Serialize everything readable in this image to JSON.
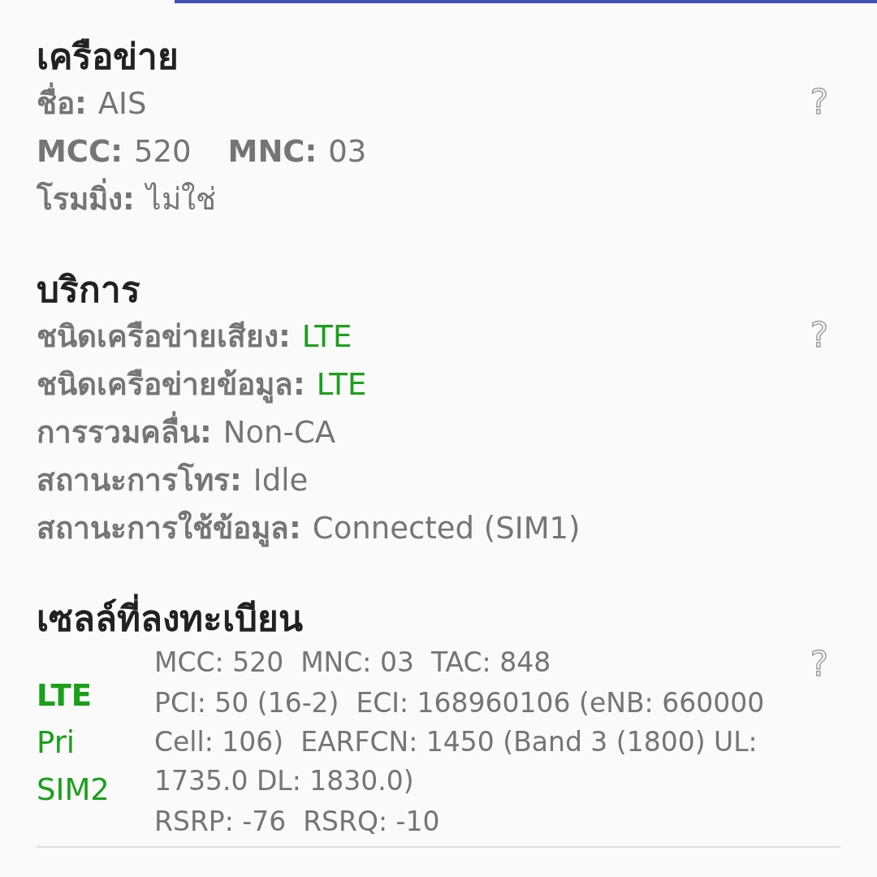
{
  "sections": [
    {
      "kind": "fields",
      "title": "เครือข่าย",
      "help": "?",
      "rows": [
        [
          {
            "label": "ชื่อ:",
            "value": "AIS"
          }
        ],
        [
          {
            "label": "MCC:",
            "value": "520"
          },
          {
            "label": "MNC:",
            "value": "03"
          }
        ],
        [
          {
            "label": "โรมมิ่ง:",
            "value": "ไม่ใช่"
          }
        ]
      ]
    },
    {
      "kind": "fields",
      "title": "บริการ",
      "help": "?",
      "rows": [
        [
          {
            "label": "ชนิดเครือข่ายเสียง:",
            "value": "LTE",
            "color": "#1aa01a"
          }
        ],
        [
          {
            "label": "ชนิดเครือข่ายข้อมูล:",
            "value": "LTE",
            "color": "#1aa01a"
          }
        ],
        [
          {
            "label": "การรวมคลื่น:",
            "value": "Non-CA"
          }
        ],
        [
          {
            "label": "สถานะการโทร:",
            "value": "Idle"
          }
        ],
        [
          {
            "label": "สถานะการใช้ข้อมูล:",
            "value": "Connected (SIM1)"
          }
        ]
      ]
    },
    {
      "kind": "cell",
      "title": "เซลล์ที่ลงทะเบียน",
      "help": "?",
      "tags": [
        {
          "text": "LTE",
          "bold": true
        },
        {
          "text": "Pri",
          "bold": false
        },
        {
          "text": "SIM2",
          "bold": false
        }
      ],
      "lines": [
        "MCC: 520  MNC: 03  TAC: 848",
        "PCI: 50 (16-2)  ECI: 168960106 (eNB: 660000 Cell: 106)  EARFCN: 1450 (Band 3 (1800) UL: 1735.0 DL: 1830.0)",
        "RSRP: -76  RSRQ: -10"
      ]
    }
  ]
}
